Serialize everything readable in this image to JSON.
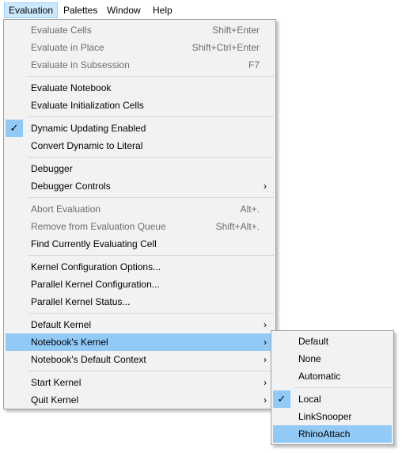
{
  "menubar": {
    "items": [
      "Evaluation",
      "Palettes",
      "Window",
      "Help"
    ]
  },
  "evaluation_menu": {
    "items": [
      {
        "label": "Evaluate Cells",
        "shortcut": "Shift+Enter"
      },
      {
        "label": "Evaluate in Place",
        "shortcut": "Shift+Ctrl+Enter"
      },
      {
        "label": "Evaluate in Subsession",
        "shortcut": "F7"
      },
      {
        "label": "Evaluate Notebook"
      },
      {
        "label": "Evaluate Initialization Cells"
      },
      {
        "label": "Dynamic Updating Enabled",
        "checked": true
      },
      {
        "label": "Convert Dynamic to Literal"
      },
      {
        "label": "Debugger"
      },
      {
        "label": "Debugger Controls"
      },
      {
        "label": "Abort Evaluation",
        "shortcut": "Alt+."
      },
      {
        "label": "Remove from Evaluation Queue",
        "shortcut": "Shift+Alt+."
      },
      {
        "label": "Find Currently Evaluating Cell"
      },
      {
        "label": "Kernel Configuration Options..."
      },
      {
        "label": "Parallel Kernel Configuration..."
      },
      {
        "label": "Parallel Kernel Status..."
      },
      {
        "label": "Default Kernel"
      },
      {
        "label": "Notebook's Kernel"
      },
      {
        "label": "Notebook's Default Context"
      },
      {
        "label": "Start Kernel"
      },
      {
        "label": "Quit Kernel"
      }
    ]
  },
  "kernel_submenu": {
    "items": [
      {
        "label": "Default"
      },
      {
        "label": "None"
      },
      {
        "label": "Automatic"
      },
      {
        "label": "Local",
        "checked": true
      },
      {
        "label": "LinkSnooper"
      },
      {
        "label": "RhinoAttach"
      }
    ]
  },
  "glyphs": {
    "check": "✓",
    "arrow": "›"
  },
  "colors": {
    "highlight": "#91c9f7",
    "menu_bg": "#f2f2f2",
    "disabled_text": "#6d6d6d",
    "menubar_active": "#cce8ff"
  }
}
